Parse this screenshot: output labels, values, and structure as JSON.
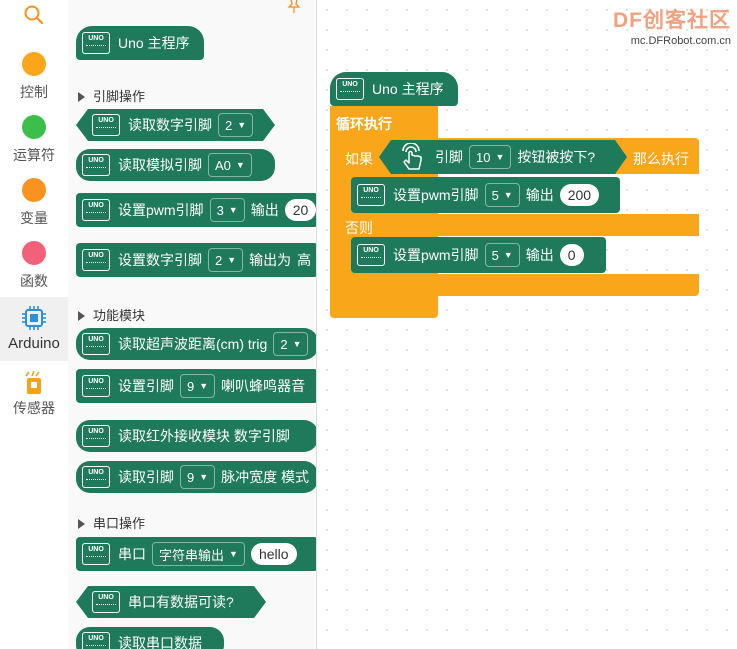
{
  "rail": {
    "search_icon": "search-icon",
    "categories": [
      {
        "label": "控制",
        "color": "#f9a61a"
      },
      {
        "label": "运算符",
        "color": "#3cbf4a"
      },
      {
        "label": "变量",
        "color": "#f7931e"
      },
      {
        "label": "函数",
        "color": "#f2617a"
      },
      {
        "label": "Arduino",
        "color": "#2d8fd5"
      },
      {
        "label": "传感器",
        "color": "#f2a31a"
      }
    ]
  },
  "palette": {
    "main_block": "Uno 主程序",
    "sections": [
      "引脚操作",
      "功能模块",
      "串口操作"
    ],
    "read_digital": {
      "label": "读取数字引脚",
      "value": "2"
    },
    "read_analog": {
      "label": "读取模拟引脚",
      "value": "A0"
    },
    "set_pwm": {
      "label": "设置pwm引脚",
      "value": "3",
      "output": "输出",
      "pill": "20"
    },
    "set_digital": {
      "label": "设置数字引脚",
      "value": "2",
      "output": "输出为",
      "tail": "高"
    },
    "ultrasonic": {
      "label": "读取超声波距离(cm) trig",
      "value": "2"
    },
    "buzzer": {
      "label": "设置引脚",
      "value": "9",
      "tail": "喇叭蜂鸣器音"
    },
    "ir": {
      "label": "读取红外接收模块 数字引脚"
    },
    "pulse": {
      "label": "读取引脚",
      "value": "9",
      "tail": "脉冲宽度 模式"
    },
    "serial": {
      "label": "串口",
      "dropdown": "字符串输出",
      "pill": "hello"
    },
    "serial_available": {
      "label": "串口有数据可读?"
    },
    "serial_read": {
      "label": "读取串口数据"
    }
  },
  "workspace": {
    "logo": {
      "brand": "DF创客社区",
      "url": "mc.DFRobot.com.cn"
    },
    "program": {
      "hat": "Uno 主程序",
      "loop": "循环执行",
      "if": "如果",
      "then": "那么执行",
      "else": "否则",
      "condition": {
        "pin_label": "引脚",
        "pin": "10",
        "suffix": "按钮被按下?"
      },
      "pwm1": {
        "label": "设置pwm引脚",
        "pin": "5",
        "output": "输出",
        "value": "200"
      },
      "pwm2": {
        "label": "设置pwm引脚",
        "pin": "5",
        "output": "输出",
        "value": "0"
      }
    }
  }
}
